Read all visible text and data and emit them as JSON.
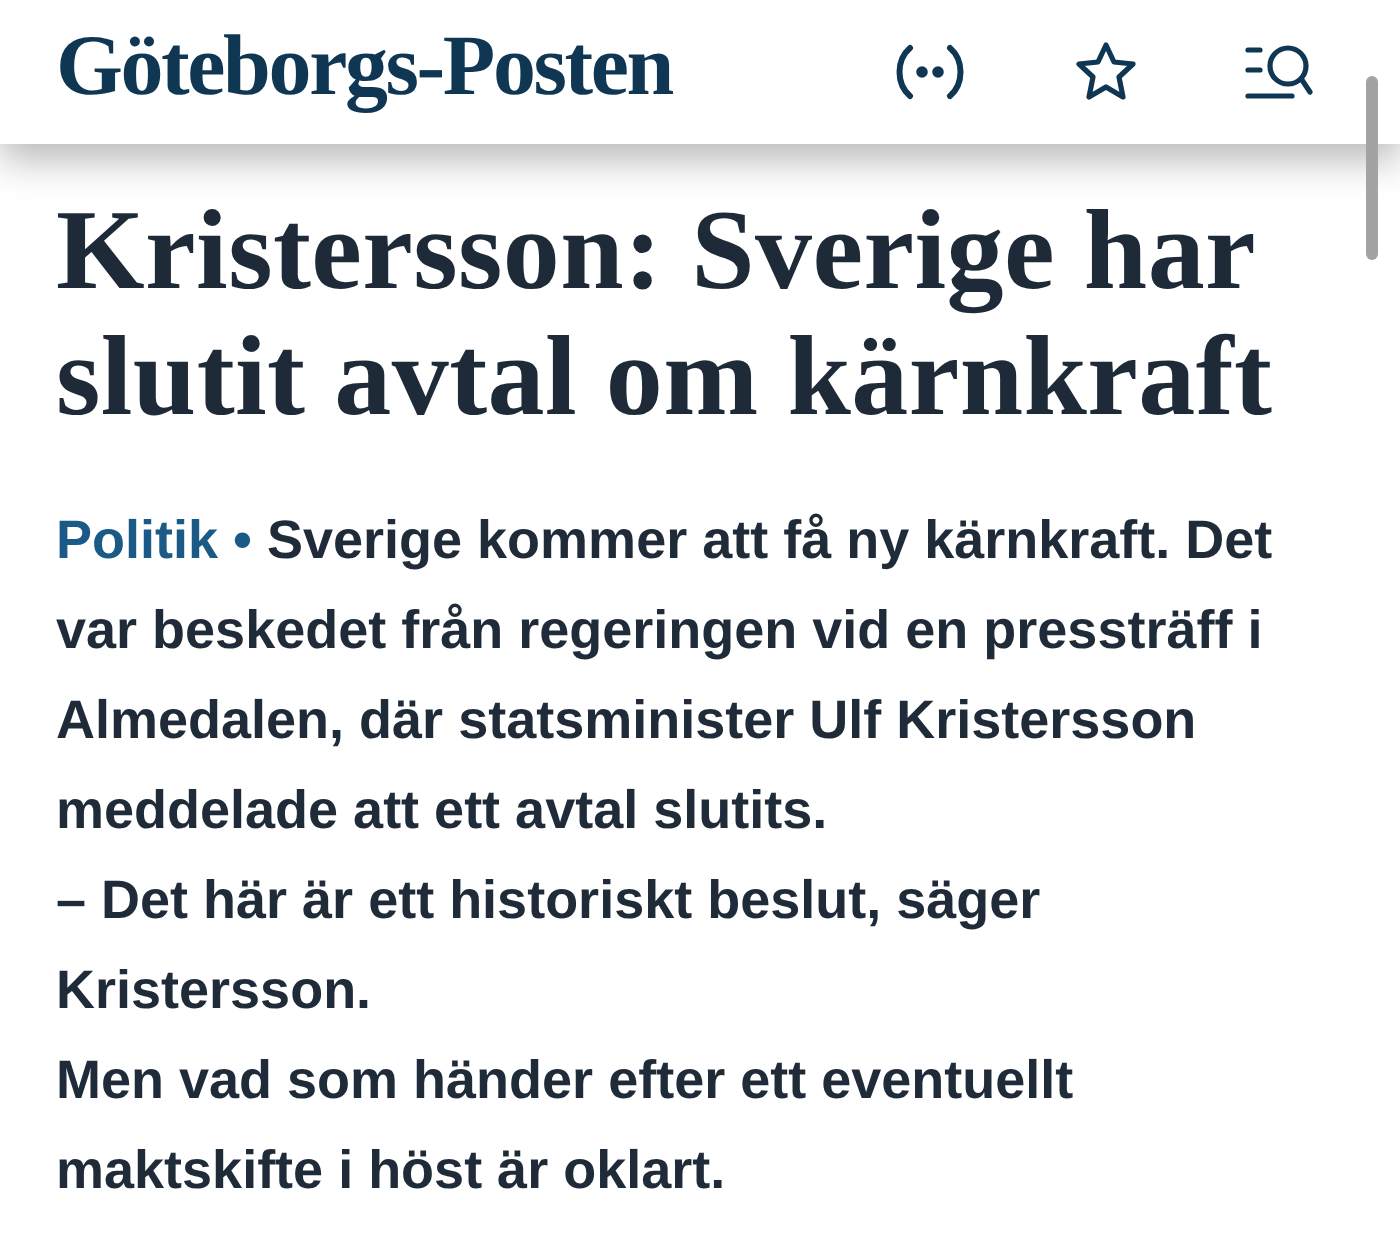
{
  "header": {
    "logo": "Göteborgs-Posten"
  },
  "article": {
    "headline": "Kristersson: Sverige har slutit avtal om kärnkraft",
    "category": "Politik",
    "separator": "•",
    "paragraphs": [
      "Sverige kommer att få ny kärnkraft. Det var beskedet från regeringen vid en pressträff i Almedalen, där statsminister Ulf Kristersson meddelade att ett avtal slutits.",
      "– Det här är ett historiskt beslut, säger Kristersson.",
      "Men vad som händer efter ett eventuellt maktskifte i höst är oklart."
    ]
  }
}
